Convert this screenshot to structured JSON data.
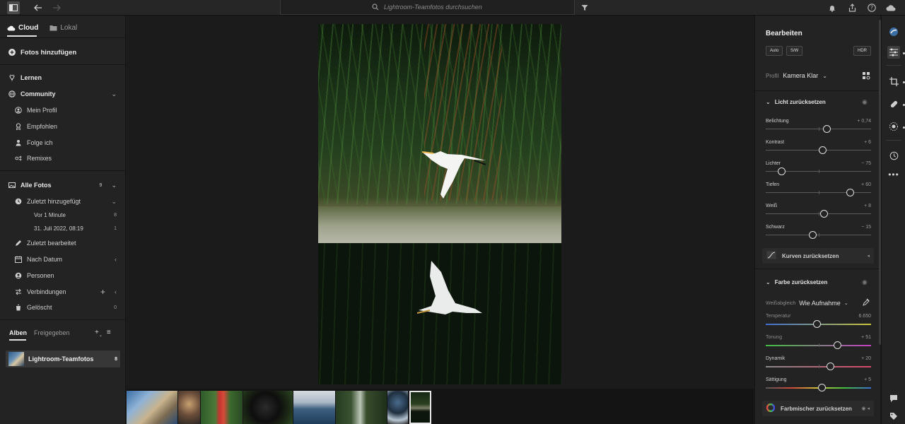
{
  "topbar": {
    "search_placeholder": "Lightroom-Teamfotos durchsuchen",
    "icons": [
      "panel-toggle-icon",
      "back-arrow-icon",
      "forward-arrow-icon",
      "search-icon",
      "filter-icon",
      "bell-icon",
      "share-icon",
      "help-icon",
      "cloud-status-icon"
    ]
  },
  "sidebar": {
    "tabs": [
      "Cloud",
      "Lokal"
    ],
    "active_tab": "Cloud",
    "add_photos": "Fotos hinzufügen",
    "learn": "Lernen",
    "community": {
      "label": "Community",
      "items": [
        "Mein Profil",
        "Empfohlen",
        "Folge ich",
        "Remixes"
      ]
    },
    "all_photos": {
      "label": "Alle Fotos",
      "count": "9"
    },
    "recently_added": {
      "label": "Zuletzt hinzugefügt",
      "items": [
        {
          "label": "Vor 1 Minute",
          "count": "8"
        },
        {
          "label": "31. Juli 2022, 08:19",
          "count": "1"
        }
      ]
    },
    "recently_edited": "Zuletzt bearbeitet",
    "by_date": "Nach Datum",
    "people": "Personen",
    "connections": "Verbindungen",
    "deleted": {
      "label": "Gelöscht",
      "count": "0"
    },
    "album_tabs": [
      "Alben",
      "Freigegeben"
    ],
    "albums": [
      {
        "label": "Lightroom-Teamfotos",
        "count": "8"
      }
    ]
  },
  "edit": {
    "title": "Bearbeiten",
    "chips": [
      "Auto",
      "S/W",
      "HDR"
    ],
    "profile_label": "Profil",
    "profile_value": "Kamera Klar",
    "light": {
      "section": "Licht zurücksetzen",
      "sliders": [
        {
          "label": "Belichtung",
          "value": "+ 0,74",
          "pos": 0.58
        },
        {
          "label": "Kontrast",
          "value": "+ 6",
          "pos": 0.54
        },
        {
          "label": "Lichter",
          "value": "− 75",
          "pos": 0.15
        },
        {
          "label": "Tiefen",
          "value": "+ 60",
          "pos": 0.8
        },
        {
          "label": "Weiß",
          "value": "+ 8",
          "pos": 0.55
        },
        {
          "label": "Schwarz",
          "value": "− 15",
          "pos": 0.44
        }
      ],
      "curves": "Kurven zurücksetzen"
    },
    "color": {
      "section": "Farbe zurücksetzen",
      "wb_label": "Weißabgleich",
      "wb_value": "Wie Aufnahme",
      "sliders": [
        {
          "label": "Temperatur",
          "value": "6.650",
          "pos": 0.48
        },
        {
          "label": "Tonung",
          "value": "+ 51",
          "pos": 0.68
        },
        {
          "label": "Dynamik",
          "value": "+ 20",
          "pos": 0.61
        },
        {
          "label": "Sättigung",
          "value": "+ 5",
          "pos": 0.53
        }
      ],
      "mixer": "Farbmischer zurücksetzen"
    }
  },
  "colors": {
    "background": "#1b1b1b",
    "panel": "#232323",
    "accent_text": "#eeeeee"
  }
}
